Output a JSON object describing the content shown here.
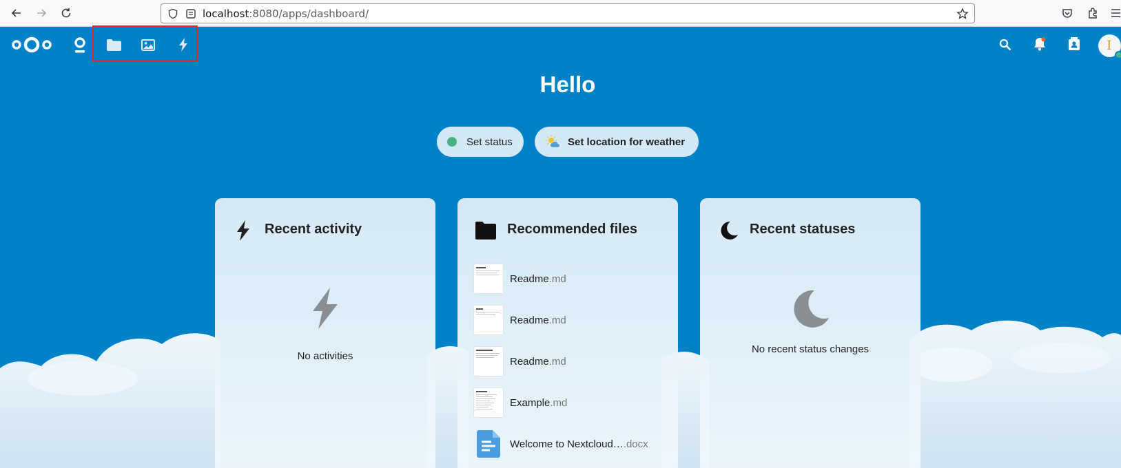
{
  "browser": {
    "url_host": "localhost",
    "url_rest": ":8080/apps/dashboard/"
  },
  "header": {
    "apps": [
      "Dashboard",
      "Files",
      "Photos",
      "Activity"
    ],
    "avatar_letter": "I"
  },
  "greeting": "Hello",
  "status_buttons": {
    "set_status": "Set status",
    "weather": "Set location for weather"
  },
  "panels": {
    "activity": {
      "title": "Recent activity",
      "empty": "No activities"
    },
    "files": {
      "title": "Recommended files",
      "items": [
        {
          "name": "Readme",
          "ext": ".md"
        },
        {
          "name": "Readme",
          "ext": ".md"
        },
        {
          "name": "Readme",
          "ext": ".md"
        },
        {
          "name": "Example",
          "ext": ".md"
        },
        {
          "name": "Welcome to Nextcloud…",
          "ext": ".docx"
        }
      ]
    },
    "statuses": {
      "title": "Recent statuses",
      "empty": "No recent status changes"
    }
  },
  "colors": {
    "brand": "#0082c9",
    "status_online": "#49b382",
    "highlight": "#e0262b"
  }
}
